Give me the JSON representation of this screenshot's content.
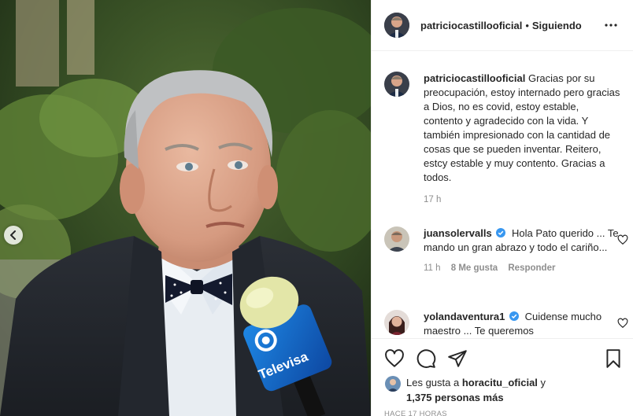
{
  "post": {
    "author": "patriciocastillooficial",
    "separator": "•",
    "follow_status": "Siguiendo"
  },
  "caption": {
    "username": "patriciocastillooficial",
    "text": "Gracias por su preocupación, estoy internado pero gracias a Dios, no es covid, estoy estable, contento y agradecido con la vida. Y también impresionado con la cantidad de cosas que se pueden inventar. Reitero, estcy estable y muy contento. Gracias a todos.",
    "time": "17 h"
  },
  "comments": [
    {
      "username": "juansolervalls",
      "text": "Hola Pato querido ... Te mando un gran abrazo y todo el cariño...",
      "time": "11 h",
      "likes": "8 Me gusta",
      "reply": "Responder"
    },
    {
      "username": "yolandaventura1",
      "text": "Cuidense mucho maestro ... Te queremos",
      "time": "",
      "likes": "",
      "reply": ""
    }
  ],
  "likes": {
    "prefix": "Les gusta a",
    "user": "horacitu_oficial",
    "joiner": "y",
    "count": "1,375 personas más"
  },
  "posted_ago": "HACE 17 HORAS",
  "photo": {
    "microphone_brand": "Televisa"
  },
  "icons": {
    "more": "more-options-icon",
    "like": "heart-icon",
    "comment": "comment-icon",
    "share": "share-icon",
    "save": "bookmark-icon",
    "verified": "verified-badge-icon",
    "prev": "chevron-left-icon"
  },
  "colors": {
    "text": "#262626",
    "muted": "#8e8e8e",
    "verified": "#3897f0",
    "border": "#efefef",
    "mic_blue": "#1565c0"
  }
}
